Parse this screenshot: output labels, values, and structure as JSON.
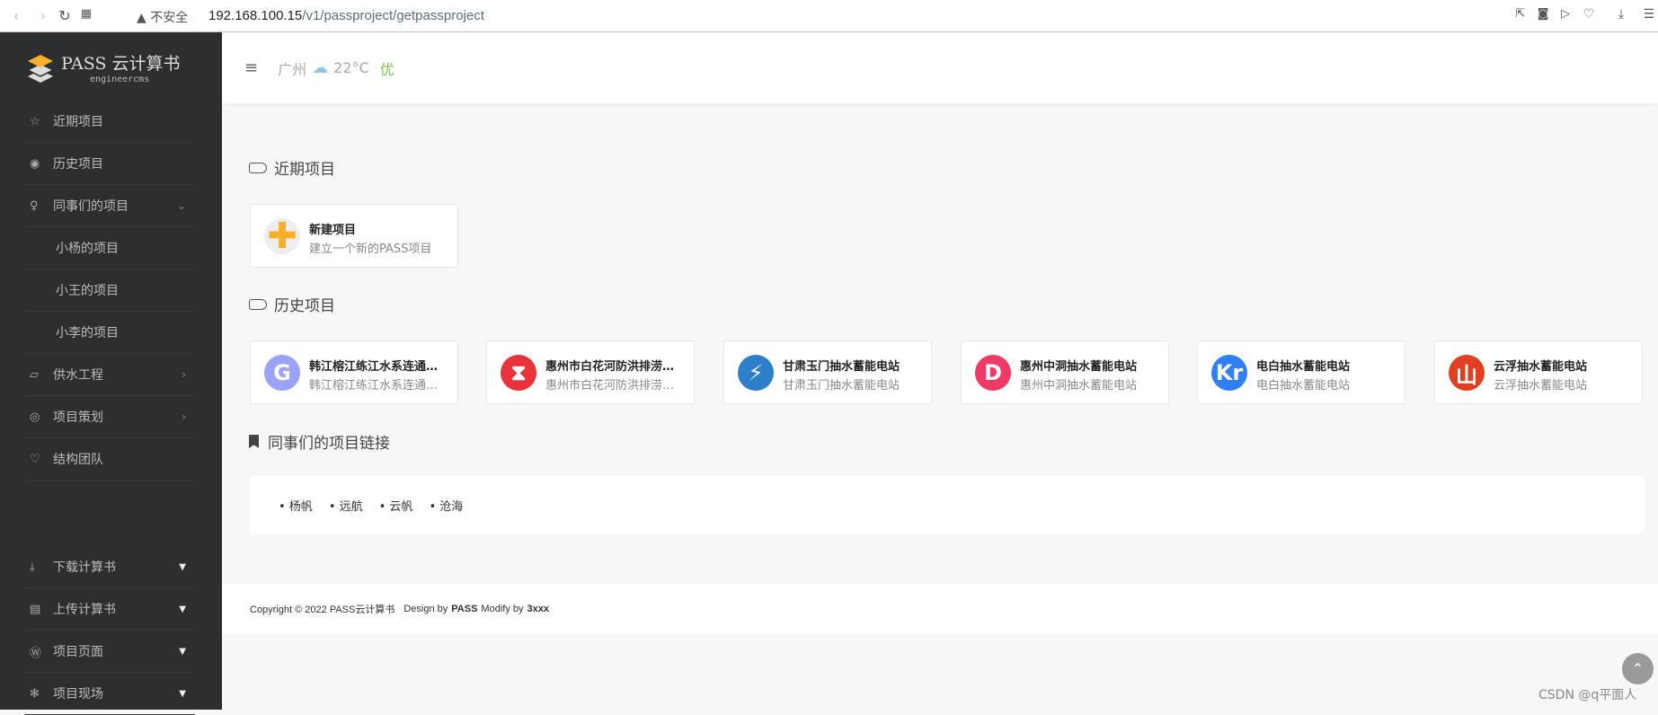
{
  "browser": {
    "insecure": "不安全",
    "url_host": "192.168.100.15",
    "url_path": "/v1/passproject/getpassproject"
  },
  "logo": {
    "title": "PASS 云计算书",
    "subtitle": "engineercms"
  },
  "sidebar": {
    "items": [
      {
        "label": "近期项目",
        "icon": "star-icon",
        "glyph": "☆"
      },
      {
        "label": "历史项目",
        "icon": "podcast-icon",
        "glyph": "◉"
      },
      {
        "label": "同事们的项目",
        "icon": "lightbulb-icon",
        "glyph": "♀",
        "arrow": "⌄"
      },
      {
        "label": "小杨的项目"
      },
      {
        "label": "小王的项目"
      },
      {
        "label": "小李的项目"
      },
      {
        "label": "供水工程",
        "icon": "folder-open-icon",
        "glyph": "▱",
        "arrow": "›"
      },
      {
        "label": "项目策划",
        "icon": "bullseye-icon",
        "glyph": "◎",
        "arrow": "›"
      },
      {
        "label": "结构团队",
        "icon": "heart-icon",
        "glyph": "♡"
      }
    ],
    "bottom": [
      {
        "label": "下载计算书",
        "icon": "download-icon",
        "glyph": "⤓"
      },
      {
        "label": "上传计算书",
        "icon": "newspaper-icon",
        "glyph": "▤"
      },
      {
        "label": "项目页面",
        "icon": "wordpress-icon",
        "glyph": "Ⓦ"
      },
      {
        "label": "项目现场",
        "icon": "yelp-icon",
        "glyph": "✻"
      }
    ],
    "caret": "▼"
  },
  "header": {
    "city": "广州",
    "temp": "22°C",
    "air": "优",
    "air_color": "#7ac943"
  },
  "recent": {
    "title": "近期项目",
    "new_title": "新建项目",
    "new_sub": "建立一个新的PASS项目"
  },
  "history": {
    "title": "历史项目",
    "projects": [
      {
        "title": "韩江榕江练江水系连通工程",
        "sub": "韩江榕江练江水系连通工程",
        "letter": "G",
        "color": "#9aa3f7"
      },
      {
        "title": "惠州市白花河防洪排涝工程",
        "sub": "惠州市白花河防洪排涝工程",
        "letter": "⧗",
        "color": "#e8323c"
      },
      {
        "title": "甘肃玉门抽水蓄能电站",
        "sub": "甘肃玉门抽水蓄能电站",
        "letter": "⚡",
        "color": "#2d7fc9"
      },
      {
        "title": "惠州中洞抽水蓄能电站",
        "sub": "惠州中洞抽水蓄能电站",
        "letter": "D",
        "color": "#f03a66"
      },
      {
        "title": "电白抽水蓄能电站",
        "sub": "电白抽水蓄能电站",
        "letter": "Kr",
        "color": "#2f7ff5"
      },
      {
        "title": "云浮抽水蓄能电站",
        "sub": "云浮抽水蓄能电站",
        "letter": "山",
        "color": "#e0401f"
      }
    ]
  },
  "colleagues": {
    "title": "同事们的项目链接",
    "links": [
      "• 杨帆",
      "• 远航",
      "• 云帆",
      "• 沧海"
    ]
  },
  "footer": {
    "copyright": "Copyright © 2022 PASS云计算书",
    "design": "Design by",
    "design_name": "PASS",
    "modify": "Modify by",
    "modify_name": "3xxx"
  },
  "watermark": "CSDN @q平面人"
}
